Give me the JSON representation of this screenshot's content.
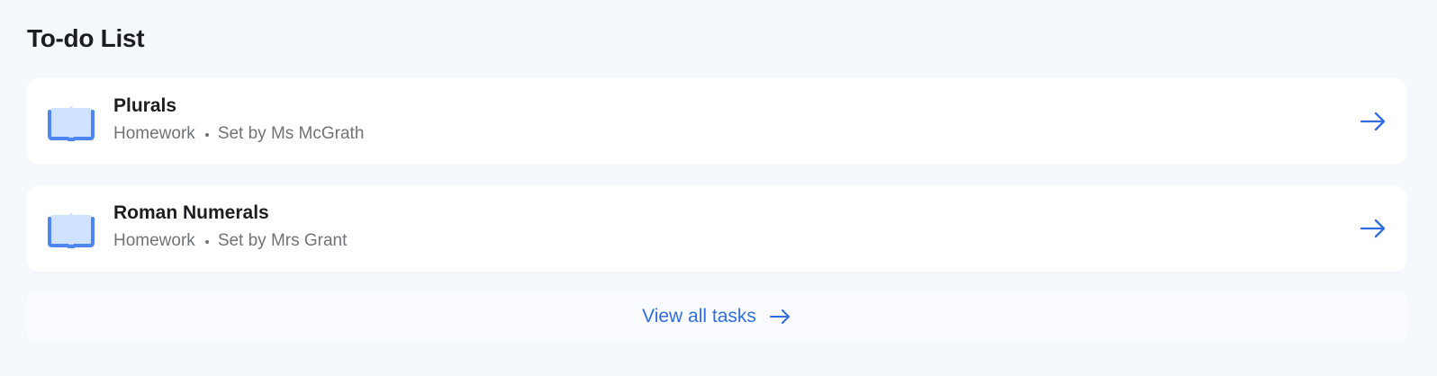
{
  "todo_list": {
    "title": "To-do List",
    "tasks": [
      {
        "name": "Plurals",
        "type": "Homework",
        "set_by": "Set by Ms McGrath",
        "icon": "book-icon",
        "action_icon": "arrow-right-icon"
      },
      {
        "name": "Roman Numerals",
        "type": "Homework",
        "set_by": "Set by Mrs Grant",
        "icon": "book-icon",
        "action_icon": "arrow-right-icon"
      }
    ],
    "view_all": {
      "label": "View all tasks",
      "icon": "arrow-right-icon"
    }
  },
  "colors": {
    "background": "#f5f8fd",
    "card": "#ffffff",
    "accent_blue": "#2f6de0",
    "book_blue": "#4d86f2",
    "book_light": "#cfe2ff",
    "muted_text": "#6f7378"
  }
}
